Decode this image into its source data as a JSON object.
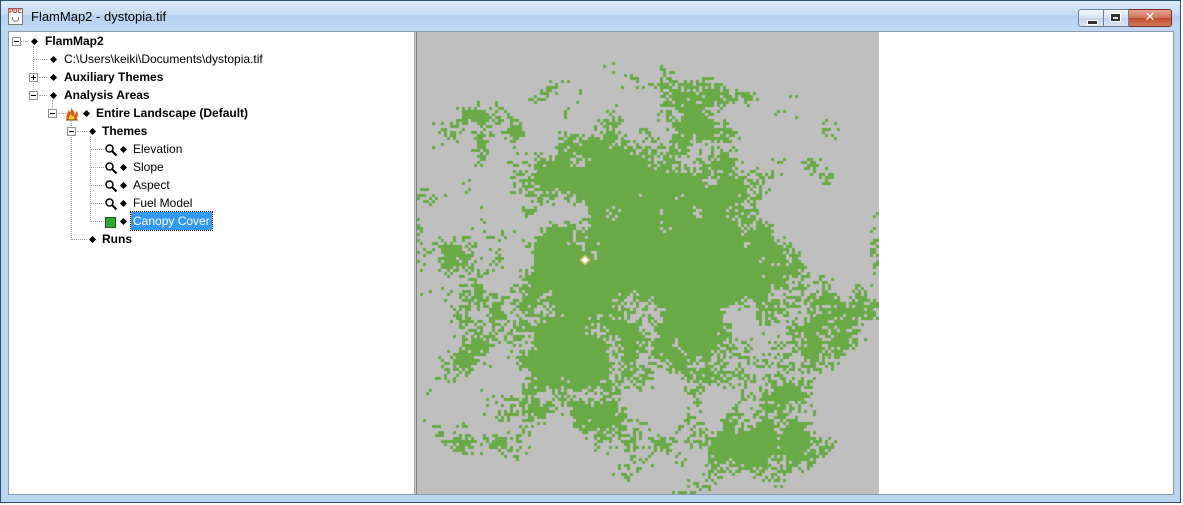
{
  "window": {
    "title": "FlamMap2 - dystopia.tif",
    "app_icon_text": "PDC"
  },
  "tree": {
    "root": {
      "label": "FlamMap2"
    },
    "file": {
      "label": "C:\\Users\\keiki\\Documents\\dystopia.tif"
    },
    "auxiliary": {
      "label": "Auxiliary Themes"
    },
    "analysis": {
      "label": "Analysis Areas"
    },
    "landscape": {
      "label": "Entire Landscape (Default)"
    },
    "themes": {
      "label": "Themes"
    },
    "theme_items": [
      {
        "label": "Elevation",
        "icon": "magnifier-icon"
      },
      {
        "label": "Slope",
        "icon": "magnifier-icon"
      },
      {
        "label": "Aspect",
        "icon": "magnifier-icon"
      },
      {
        "label": "Fuel Model",
        "icon": "magnifier-icon"
      },
      {
        "label": "Canopy Cover",
        "icon": "green-swatch-icon",
        "selected": true
      }
    ],
    "runs": {
      "label": "Runs"
    }
  },
  "map": {
    "background_color": "#bfbfbf",
    "canopy_color": "#6aaa46",
    "marker_color": "#f4c070"
  },
  "colors": {
    "selection": "#3399ff",
    "titlebar": "#c6dcf3",
    "close_button": "#c24a2e"
  }
}
